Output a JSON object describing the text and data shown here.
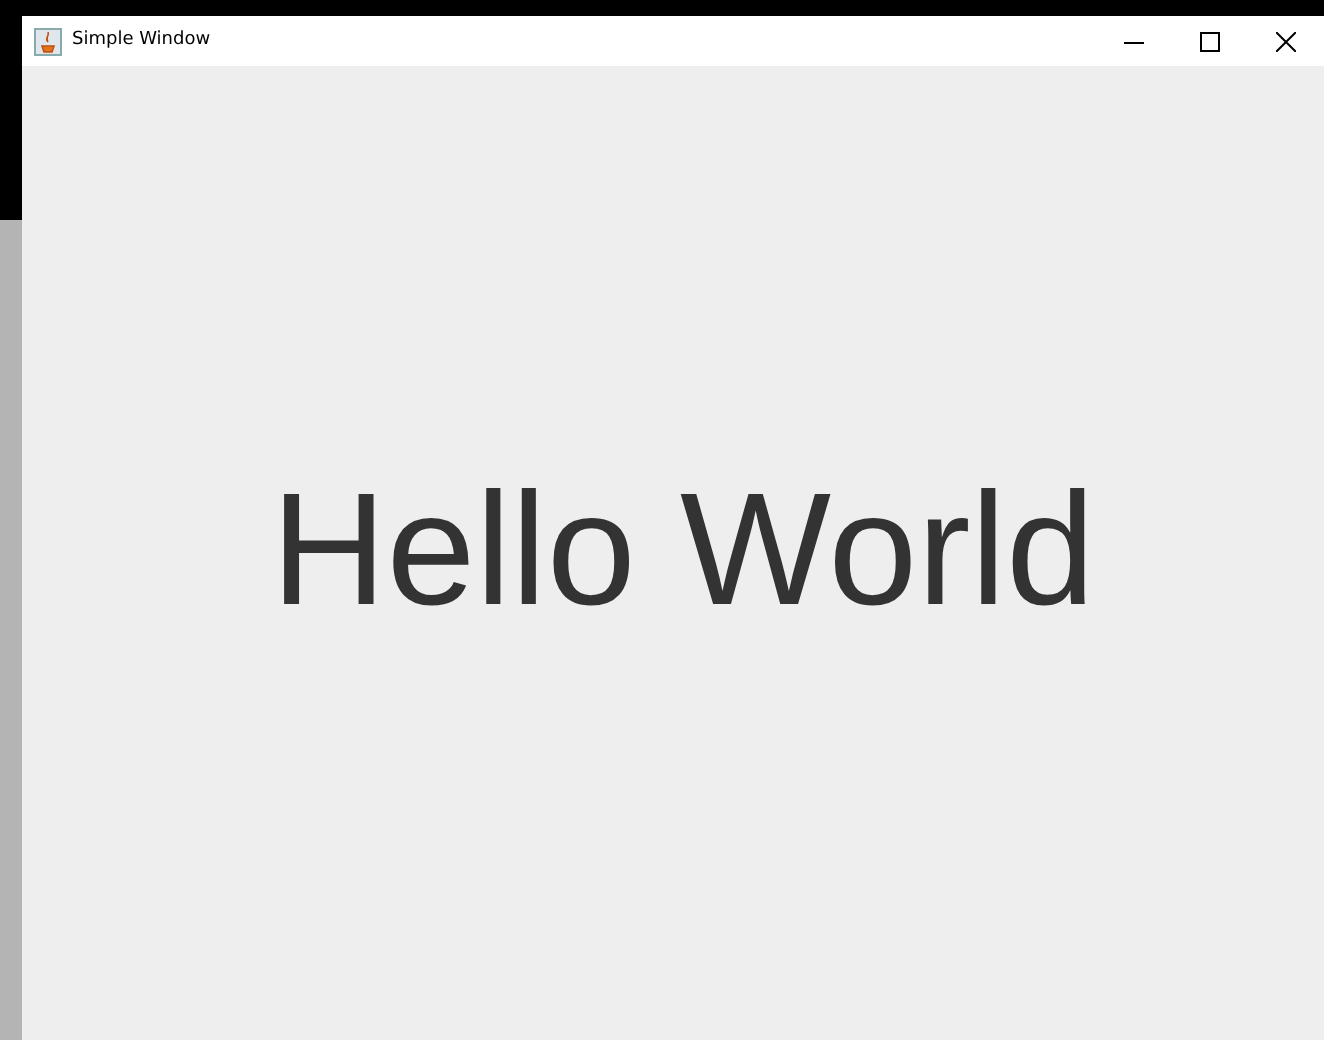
{
  "window": {
    "title": "Simple Window"
  },
  "content": {
    "message": "Hello World"
  }
}
